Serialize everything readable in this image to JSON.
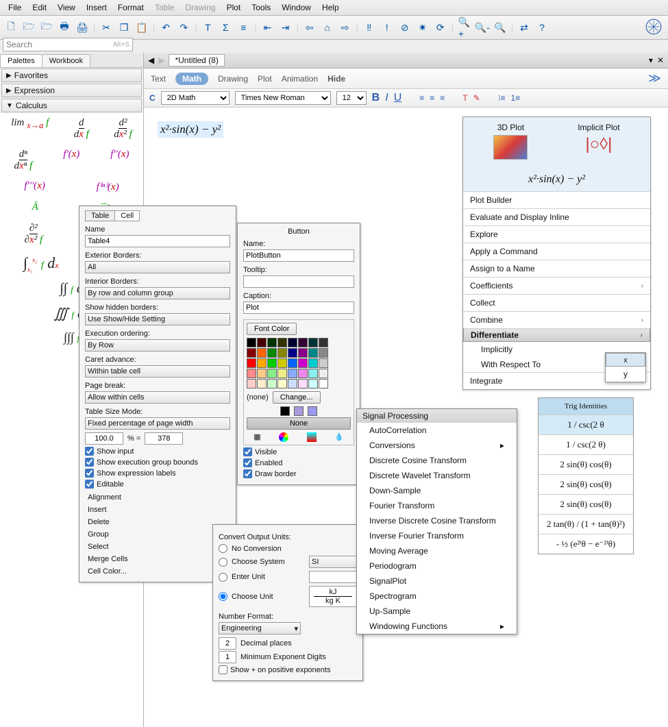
{
  "menu": {
    "items": [
      "File",
      "Edit",
      "View",
      "Insert",
      "Format",
      "Table",
      "Drawing",
      "Plot",
      "Tools",
      "Window",
      "Help"
    ]
  },
  "search": {
    "placeholder": "Search",
    "shortcut": "Alt+S"
  },
  "palette": {
    "tabs": [
      "Palettes",
      "Workbook"
    ],
    "sections": {
      "fav": "Favorites",
      "expr": "Expression",
      "calc": "Calculus"
    }
  },
  "doc": {
    "title": "*Untitled (8)",
    "tabs": {
      "text": "Text",
      "math": "Math",
      "drawing": "Drawing",
      "plot": "Plot",
      "anim": "Animation",
      "hide": "Hide"
    },
    "fmt": {
      "mode": "2D Math",
      "font": "Times New Roman",
      "size": "12"
    },
    "expression": "x²·sin(x) − y²"
  },
  "context": {
    "plot3d": "3D Plot",
    "implicit": "Implicit Plot",
    "expr": "x²·sin(x) − y²",
    "items": [
      "Plot Builder",
      "Evaluate and Display Inline",
      "Explore",
      "Apply a Command",
      "Assign to a Name",
      "Coefficients",
      "Collect",
      "Combine"
    ],
    "diff": "Differentiate",
    "diff_impl": "Implicitly",
    "diff_wrt": "With Respect To",
    "integrate": "Integrate",
    "vars": [
      "x",
      "y"
    ]
  },
  "table_dlg": {
    "tabs": [
      "Table",
      "Cell"
    ],
    "name_lbl": "Name",
    "name": "Table4",
    "ext_lbl": "Exterior Borders:",
    "ext": "All",
    "int_lbl": "Interior Borders:",
    "int": "By row and column group",
    "hidden_lbl": "Show hidden borders:",
    "hidden": "Use Show/Hide Setting",
    "exec_lbl": "Execution ordering:",
    "exec": "By Row",
    "caret_lbl": "Caret advance:",
    "caret": "Within table cell",
    "pgbrk_lbl": "Page break:",
    "pgbrk": "Allow within cells",
    "size_lbl": "Table Size Mode:",
    "size": "Fixed percentage of page width",
    "pct": "100.0",
    "pct_eq": "%  =",
    "px": "378",
    "chk1": "Show input",
    "chk2": "Show execution group bounds",
    "chk3": "Show expression labels",
    "chk4": "Editable",
    "actions": [
      "Alignment",
      "Insert",
      "Delete",
      "Group",
      "Select",
      "Merge Cells",
      "Cell Color..."
    ]
  },
  "button_dlg": {
    "title": "Button",
    "name_lbl": "Name:",
    "name": "PlotButton",
    "tooltip_lbl": "Tooltip:",
    "tooltip": "",
    "caption_lbl": "Caption:",
    "caption": "Plot",
    "fontcolor": "Font Color",
    "none": "(none)",
    "change": "Change...",
    "none_btn": "None",
    "visible": "Visible",
    "enabled": "Enabled",
    "draw": "Draw border"
  },
  "units_dlg": {
    "title": "Convert Output Units:",
    "noconv": "No Conversion",
    "choosesys": "Choose System",
    "sys": "SI",
    "enterunit": "Enter Unit",
    "chooseunit": "Choose Unit",
    "unit_top": "kJ",
    "unit_bot": "kg K",
    "numfmt": "Number Format:",
    "fmt": "Engineering",
    "dec": "2",
    "dec_lbl": "Decimal places",
    "exp": "1",
    "exp_lbl": "Minimum Exponent Digits",
    "showplus": "Show + on positive exponents"
  },
  "sigproc": {
    "title": "Signal Processing",
    "items": [
      "AutoCorrelation",
      "Conversions",
      "Discrete Cosine Transform",
      "Discrete Wavelet Transform",
      "Down-Sample",
      "Fourier Transform",
      "Inverse Discrete Cosine Transform",
      "Inverse Fourier Transform",
      "Moving Average",
      "Periodogram",
      "SignalPlot",
      "Spectrogram",
      "Up-Sample",
      "Windowing Functions"
    ]
  },
  "trig": {
    "title": "Trig Identities",
    "top": "1 / csc(2 θ",
    "rows": [
      "1 / csc(2 θ)",
      "2 sin(θ) cos(θ)",
      "2 sin(θ) cos(θ)",
      "2 sin(θ) cos(θ)",
      "2 tan(θ) / (1 + tan(θ)²)",
      "- ½ (e²ⁱθ − e⁻²ⁱθ)"
    ]
  }
}
